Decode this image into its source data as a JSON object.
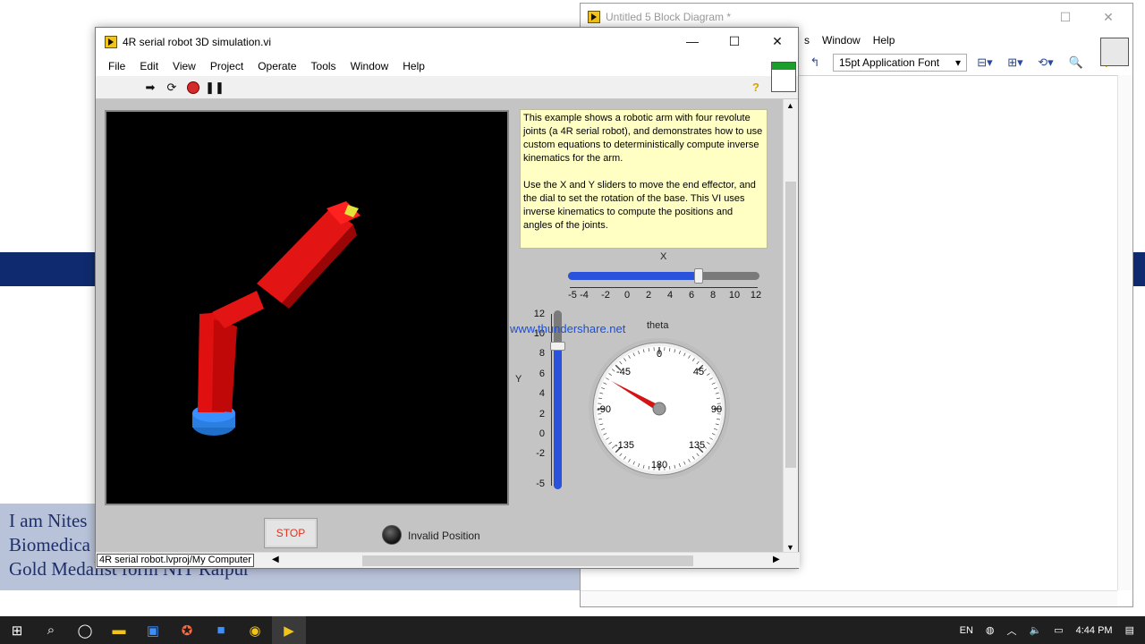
{
  "background": {
    "caption_lines": [
      "I am Nites",
      "Biomedica",
      "Gold Medalist form NIT Raipur"
    ],
    "band_color": "#0f2a6e"
  },
  "block_diagram": {
    "title": "Untitled 5 Block Diagram *",
    "menu": [
      "s",
      "Window",
      "Help"
    ],
    "font_selector": "15pt Application Font"
  },
  "front_panel": {
    "title": "4R serial robot 3D simulation.vi",
    "menu": [
      "File",
      "Edit",
      "View",
      "Project",
      "Operate",
      "Tools",
      "Window",
      "Help"
    ],
    "description": [
      "This example shows a robotic arm with four revolute joints (a 4R serial robot), and demonstrates how to use custom equations to deterministically compute inverse kinematics for the arm.",
      "Use the X and Y sliders to move the end effector, and the dial to set the rotation of the base. This VI uses inverse kinematics to compute the positions and angles of the joints."
    ],
    "x_slider": {
      "label": "X",
      "ticks": [
        "-5",
        "-4",
        "-2",
        "0",
        "2",
        "4",
        "6",
        "8",
        "10",
        "12"
      ],
      "value": 6.6,
      "min": -5,
      "max": 12
    },
    "y_slider": {
      "label": "Y",
      "ticks": [
        "12",
        "10",
        "8",
        "6",
        "4",
        "2",
        "0",
        "-2",
        "-5"
      ],
      "value": 8.6,
      "min": -5,
      "max": 12
    },
    "watermark": "www.thundershare.net",
    "dial": {
      "label": "theta",
      "ticks": [
        "0",
        "45",
        "90",
        "135",
        "180",
        "-135",
        "-90",
        "-45"
      ],
      "value": -60
    },
    "stop_label": "STOP",
    "led_label": "Invalid Position",
    "project_path": "4R serial robot.lvproj/My Computer"
  },
  "taskbar": {
    "language": "EN",
    "time": "4:44 PM"
  }
}
